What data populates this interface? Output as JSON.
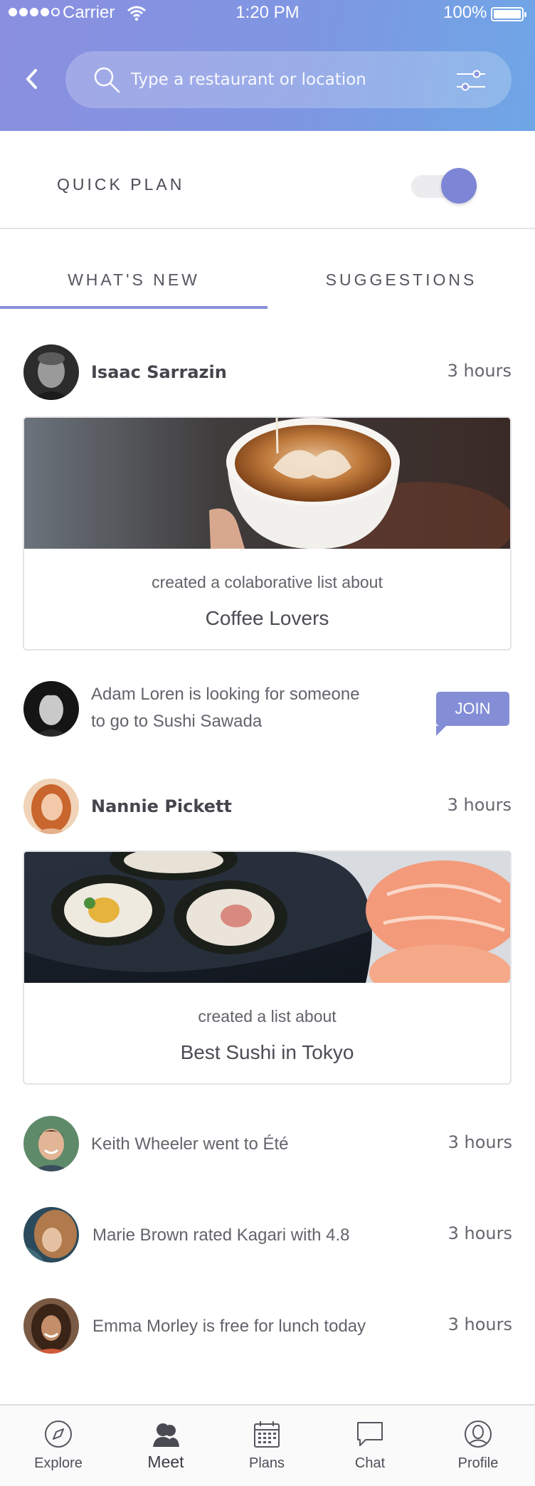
{
  "status_bar": {
    "carrier": "Carrier",
    "time": "1:20 PM",
    "battery": "100%"
  },
  "search": {
    "placeholder": "Type a restaurant or location"
  },
  "quick_plan": {
    "label": "QUICK PLAN",
    "enabled": true
  },
  "tabs": [
    {
      "label": "WHAT'S NEW",
      "active": true
    },
    {
      "label": "SUGGESTIONS",
      "active": false
    }
  ],
  "feed": [
    {
      "type": "card",
      "name": "Isaac Sarrazin",
      "time": "3 hours",
      "subtitle": "created a colaborative list about",
      "title": "Coffee Lovers"
    },
    {
      "type": "invite",
      "text_line1": "Adam Loren is looking for someone",
      "text_line2": "to go to Sushi Sawada",
      "action": "JOIN"
    },
    {
      "type": "card",
      "name": "Nannie Pickett",
      "time": "3 hours",
      "subtitle": "created a list about",
      "title": "Best Sushi in Tokyo"
    },
    {
      "type": "activity",
      "text": "Keith Wheeler went to Été",
      "time": "3 hours"
    },
    {
      "type": "activity",
      "text": "Marie Brown rated Kagari with 4.8",
      "time": "3 hours"
    },
    {
      "type": "activity",
      "text": "Emma Morley is free for lunch today",
      "time": "3 hours"
    }
  ],
  "bottom_nav": [
    {
      "label": "Explore",
      "icon": "compass-icon",
      "active": false
    },
    {
      "label": "Meet",
      "icon": "people-icon",
      "active": true
    },
    {
      "label": "Plans",
      "icon": "calendar-icon",
      "active": false
    },
    {
      "label": "Chat",
      "icon": "chat-bubble-icon",
      "active": false
    },
    {
      "label": "Profile",
      "icon": "profile-icon",
      "active": false
    }
  ],
  "colors": {
    "accent": "#7d85d6",
    "header_gradient_start": "#8b8fe0",
    "header_gradient_end": "#6ea6e6"
  }
}
